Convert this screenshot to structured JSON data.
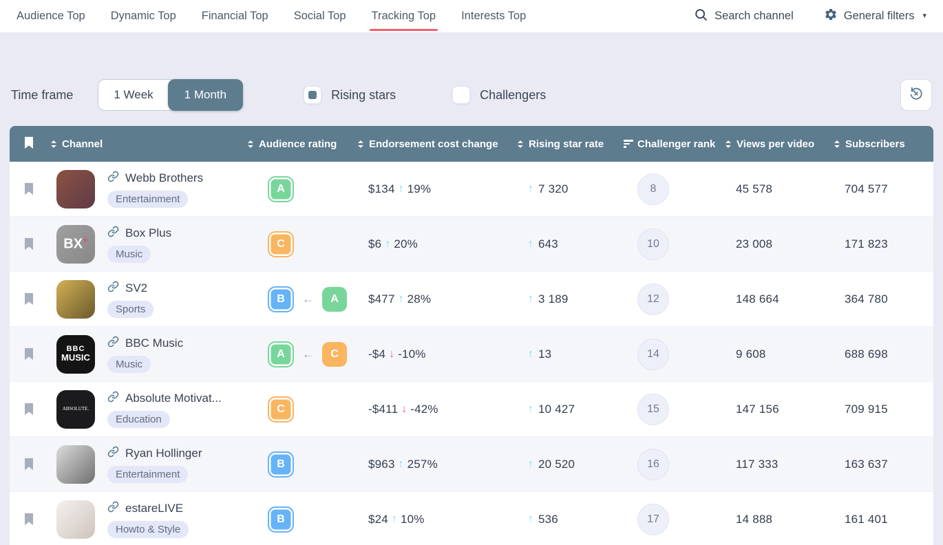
{
  "nav": {
    "tabs": [
      {
        "label": "Audience Top",
        "active": false
      },
      {
        "label": "Dynamic Top",
        "active": false
      },
      {
        "label": "Financial Top",
        "active": false
      },
      {
        "label": "Social Top",
        "active": false
      },
      {
        "label": "Tracking Top",
        "active": true
      },
      {
        "label": "Interests Top",
        "active": false
      }
    ],
    "search_label": "Search channel",
    "filters_label": "General filters",
    "accent_underline_color": "#f4606c"
  },
  "filters": {
    "time_frame_label": "Time frame",
    "time_frame_options": [
      "1 Week",
      "1 Month"
    ],
    "time_frame_selected": "1 Month",
    "checkboxes": [
      {
        "label": "Rising stars",
        "checked": true
      },
      {
        "label": "Challengers",
        "checked": false
      }
    ]
  },
  "glyphs": {
    "up": "↑",
    "down": "↓",
    "from_arrow": "←",
    "caret": "▾"
  },
  "colors": {
    "header_bg": "#5d7c8e",
    "rating_a": "#79d69b",
    "rating_b": "#66b3f7",
    "rating_c": "#f9b55f",
    "up_arrow": "#83d9f2",
    "down_arrow": "#f25c83"
  },
  "table": {
    "columns": [
      {
        "label": "",
        "icon": "bookmark"
      },
      {
        "label": "Channel",
        "icon": "sort-both"
      },
      {
        "label": "Audience rating",
        "icon": "sort-both"
      },
      {
        "label": "Endorsement cost change",
        "icon": "sort-both"
      },
      {
        "label": "Rising star rate",
        "icon": "sort-both"
      },
      {
        "label": "Challenger rank",
        "icon": "sort-active-bars"
      },
      {
        "label": "Views per video",
        "icon": "sort-both"
      },
      {
        "label": "Subscribers",
        "icon": "sort-both"
      }
    ],
    "rows": [
      {
        "channel": {
          "name": "Webb Brothers",
          "category": "Entertainment",
          "avatar": {
            "colors": [
              "#8c5242",
              "#5f3b47"
            ],
            "lines": []
          }
        },
        "rating": {
          "current": "A",
          "previous": null
        },
        "cost": {
          "amount": "$134",
          "percent": "19%",
          "direction": "up"
        },
        "rising": {
          "value": "7 320",
          "direction": "up"
        },
        "rank": "8",
        "views": "45 578",
        "subscribers": "704 577"
      },
      {
        "channel": {
          "name": "Box Plus",
          "category": "Music",
          "avatar": {
            "colors": [
              "#a0a0a0",
              "#888888"
            ],
            "lines": [
              {
                "text": "BX",
                "size": 20,
                "weight": 800,
                "accent": "+"
              }
            ]
          }
        },
        "rating": {
          "current": "C",
          "previous": null
        },
        "cost": {
          "amount": "$6",
          "percent": "20%",
          "direction": "up"
        },
        "rising": {
          "value": "643",
          "direction": "up"
        },
        "rank": "10",
        "views": "23 008",
        "subscribers": "171 823"
      },
      {
        "channel": {
          "name": "SV2",
          "category": "Sports",
          "avatar": {
            "colors": [
              "#d3b054",
              "#6b5a2c"
            ],
            "lines": []
          }
        },
        "rating": {
          "current": "B",
          "previous": "A"
        },
        "cost": {
          "amount": "$477",
          "percent": "28%",
          "direction": "up"
        },
        "rising": {
          "value": "3 189",
          "direction": "up"
        },
        "rank": "12",
        "views": "148 664",
        "subscribers": "364 780"
      },
      {
        "channel": {
          "name": "BBC Music",
          "category": "Music",
          "avatar": {
            "colors": [
              "#141414",
              "#141414"
            ],
            "lines": [
              {
                "text": "BBC",
                "size": 11,
                "weight": 800,
                "spacing": 1
              },
              {
                "text": "MUSIC",
                "size": 13,
                "weight": 800
              }
            ]
          }
        },
        "rating": {
          "current": "A",
          "previous": "C"
        },
        "cost": {
          "amount": "-$4",
          "percent": "-10%",
          "direction": "down"
        },
        "rising": {
          "value": "13",
          "direction": "up"
        },
        "rank": "14",
        "views": "9 608",
        "subscribers": "688 698"
      },
      {
        "channel": {
          "name": "Absolute Motivat...",
          "category": "Education",
          "avatar": {
            "colors": [
              "#1b1b1d",
              "#1b1b1d"
            ],
            "lines": [
              {
                "text": "ABSOLUTE.",
                "size": 7,
                "weight": 400,
                "serif": true
              }
            ]
          }
        },
        "rating": {
          "current": "C",
          "previous": null
        },
        "cost": {
          "amount": "-$411",
          "percent": "-42%",
          "direction": "down"
        },
        "rising": {
          "value": "10 427",
          "direction": "up"
        },
        "rank": "15",
        "views": "147 156",
        "subscribers": "709 915"
      },
      {
        "channel": {
          "name": "Ryan Hollinger",
          "category": "Entertainment",
          "avatar": {
            "colors": [
              "#dcdcdc",
              "#6f6f6f"
            ],
            "lines": []
          }
        },
        "rating": {
          "current": "B",
          "previous": null
        },
        "cost": {
          "amount": "$963",
          "percent": "257%",
          "direction": "up"
        },
        "rising": {
          "value": "20 520",
          "direction": "up"
        },
        "rank": "16",
        "views": "117 333",
        "subscribers": "163 637"
      },
      {
        "channel": {
          "name": "estareLIVE",
          "category": "Howto & Style",
          "avatar": {
            "colors": [
              "#f4f1f0",
              "#cfc4bd"
            ],
            "lines": []
          }
        },
        "rating": {
          "current": "B",
          "previous": null
        },
        "cost": {
          "amount": "$24",
          "percent": "10%",
          "direction": "up"
        },
        "rising": {
          "value": "536",
          "direction": "up"
        },
        "rank": "17",
        "views": "14 888",
        "subscribers": "161 401"
      }
    ]
  }
}
